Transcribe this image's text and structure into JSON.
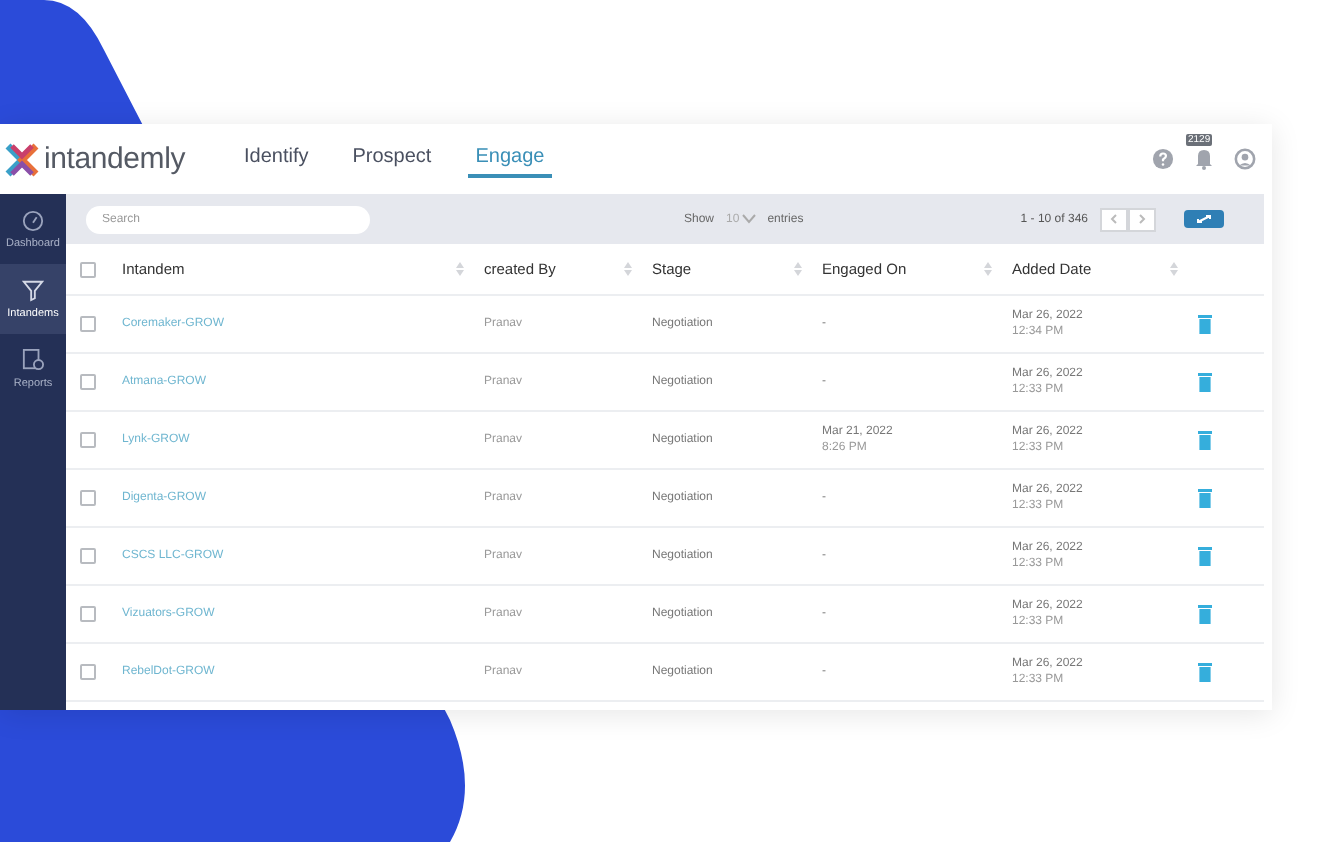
{
  "header": {
    "logo": "intandemly",
    "nav": [
      {
        "label": "Identify",
        "selected": false
      },
      {
        "label": "Prospect",
        "selected": false
      },
      {
        "label": "Engage",
        "selected": true
      }
    ],
    "notification_count": "2129"
  },
  "sidebar": {
    "items": [
      {
        "label": "Dashboard",
        "selected": false
      },
      {
        "label": "Intandems",
        "selected": true
      },
      {
        "label": "Reports",
        "selected": false
      }
    ]
  },
  "toolbar": {
    "search": {
      "placeholder": "Search"
    },
    "show_label": "Show",
    "page_size": "10",
    "entries_label": "entries",
    "pagination": "1 - 10 of 346"
  },
  "table": {
    "select_all_checked": false,
    "columns": [
      "Intandem",
      "created By",
      "Stage",
      "Engaged On",
      "Added Date"
    ],
    "rows": [
      {
        "checked": false,
        "intandem": "Coremaker-GROW",
        "created_by": "Pranav",
        "stage": "Negotiation",
        "engaged_on": [
          "-"
        ],
        "added_date": "Mar 26, 2022",
        "added_time": "12:34 PM"
      },
      {
        "checked": false,
        "intandem": "Atmana-GROW",
        "created_by": "Pranav",
        "stage": "Negotiation",
        "engaged_on": [
          "-"
        ],
        "added_date": "Mar 26, 2022",
        "added_time": "12:33 PM"
      },
      {
        "checked": false,
        "intandem": "Lynk-GROW",
        "created_by": "Pranav",
        "stage": "Negotiation",
        "engaged_on": [
          "Mar 21, 2022",
          "8:26 PM"
        ],
        "added_date": "Mar 26, 2022",
        "added_time": "12:33 PM"
      },
      {
        "checked": false,
        "intandem": "Digenta-GROW",
        "created_by": "Pranav",
        "stage": "Negotiation",
        "engaged_on": [
          "-"
        ],
        "added_date": "Mar 26, 2022",
        "added_time": "12:33 PM"
      },
      {
        "checked": false,
        "intandem": "CSCS LLC-GROW",
        "created_by": "Pranav",
        "stage": "Negotiation",
        "engaged_on": [
          "-"
        ],
        "added_date": "Mar 26, 2022",
        "added_time": "12:33 PM"
      },
      {
        "checked": false,
        "intandem": "Vizuators-GROW",
        "created_by": "Pranav",
        "stage": "Negotiation",
        "engaged_on": [
          "-"
        ],
        "added_date": "Mar 26, 2022",
        "added_time": "12:33 PM"
      },
      {
        "checked": false,
        "intandem": "RebelDot-GROW",
        "created_by": "Pranav",
        "stage": "Negotiation",
        "engaged_on": [
          "-"
        ],
        "added_date": "Mar 26, 2022",
        "added_time": "12:33 PM"
      }
    ]
  }
}
